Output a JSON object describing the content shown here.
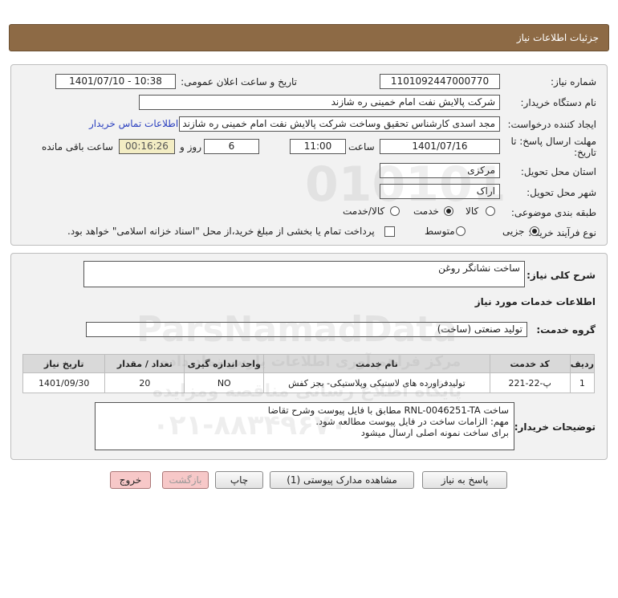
{
  "header": {
    "title": "جزئیات اطلاعات نیاز"
  },
  "form": {
    "need_number_label": "شماره نیاز:",
    "need_number": "1101092447000770",
    "announce_label": "تاریخ و ساعت اعلان عمومی:",
    "announce_value": "1401/07/10 - 10:38",
    "buyer_org_label": "نام دستگاه خریدار:",
    "buyer_org": "شرکت پالایش نفت امام خمینی  ره  شازند",
    "creator_label": "ایجاد کننده درخواست:",
    "creator": "مجد اسدی کارشناس تحقیق وساخت شرکت پالایش نفت امام خمینی  ره  شازند",
    "contact_link": "اطلاعات تماس خریدار",
    "deadline_label_1": "مهلت ارسال پاسخ: تا",
    "deadline_label_2": "تاریخ:",
    "deadline_date": "1401/07/16",
    "time_label": "ساعت",
    "deadline_time": "11:00",
    "days_value": "6",
    "days_label": "روز و",
    "remaining_time": "00:16:26",
    "remaining_label": "ساعت باقی مانده",
    "province_label": "استان محل تحویل:",
    "province": "مرکزی",
    "city_label": "شهر محل تحویل:",
    "city": "اراک",
    "category_label": "طبقه بندی موضوعی:",
    "category_options": [
      "کالا",
      "خدمت",
      "کالا/خدمت"
    ],
    "category_selected": "خدمت",
    "purchase_type_label": "نوع فرآیند خرید :",
    "purchase_options": [
      "جزیی",
      "متوسط"
    ],
    "purchase_selected": "جزیی",
    "payment_note": "پرداخت تمام یا بخشی از مبلغ خرید،از محل \"اسناد خزانه اسلامی\" خواهد بود."
  },
  "details": {
    "summary_label": "شرح کلی نیاز:",
    "summary": "ساخت نشانگر روغن",
    "services_heading": "اطلاعات خدمات مورد نیاز",
    "service_group_label": "گروه خدمت:",
    "service_group": "تولید صنعتی (ساخت)",
    "table_headers": [
      "ردیف",
      "کد خدمت",
      "نام خدمت",
      "واحد اندازه گیری",
      "تعداد / مقدار",
      "تاریخ نیاز"
    ],
    "table_rows": [
      [
        "1",
        "پ-22-221",
        "تولیدفراورده های لاستیکی وپلاستیکی- بجز کفش",
        "NO",
        "20",
        "1401/09/30"
      ]
    ],
    "buyer_notes_label": "توضیحات خریدار:",
    "buyer_notes": [
      "ساخت RNL-0046251-TA مطابق با فایل پیوست وشرح تقاضا",
      "مهم: الزامات ساخت در فایل پیوست مطالعه شود.",
      "برای ساخت نمونه اصلی ارسال میشود"
    ]
  },
  "buttons": {
    "reply": "پاسخ به نیاز",
    "view_docs": "مشاهده مدارک پیوستی (1)",
    "print": "چاپ",
    "back": "بازگشت",
    "exit": "خروج"
  },
  "watermark": {
    "brand": "ParsNamadData",
    "digits": "010101",
    "line1": "مرکز فراهم آوری اطلاعات پارس نماد داده",
    "line2": "پایگاه اطلاع رسانی مناقصه ومزایده",
    "phone": "۰۲۱-۸۸۳۴۹۶۷۰"
  },
  "colors": {
    "title_bar": "#8d6a45",
    "panel_bg": "#f2f2f2",
    "link": "#2a3fbf",
    "remaining_bg": "#f3edc4",
    "exit_button": "#f7c8c8"
  }
}
